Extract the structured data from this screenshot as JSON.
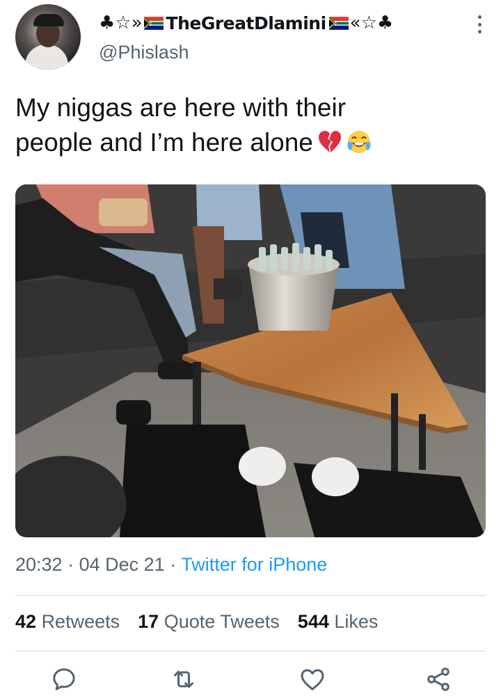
{
  "tweet": {
    "display_name": "TheGreatDlamini",
    "name_prefix": "♣☆»",
    "name_suffix": "«☆♣",
    "handle": "@Phislash",
    "text_line1": "My niggas are here with their",
    "text_line2": "people and I’m here alone",
    "emojis": [
      "broken-heart",
      "tears-of-joy"
    ],
    "time": "20:32",
    "date": "04 Dec 21",
    "source": "Twitter for iPhone",
    "sep": "·",
    "stats": {
      "retweets_count": "42",
      "retweets_label": "Retweets",
      "quotes_count": "17",
      "quotes_label": "Quote Tweets",
      "likes_count": "544",
      "likes_label": "Likes"
    }
  },
  "icons": {
    "reply": "reply-icon",
    "retweet": "retweet-icon",
    "like": "like-icon",
    "share": "share-icon",
    "more": "more-icon"
  },
  "colors": {
    "link": "#1d9bf0",
    "secondary_text": "#536471",
    "primary_text": "#0f1419",
    "divider": "#cfd9de"
  }
}
